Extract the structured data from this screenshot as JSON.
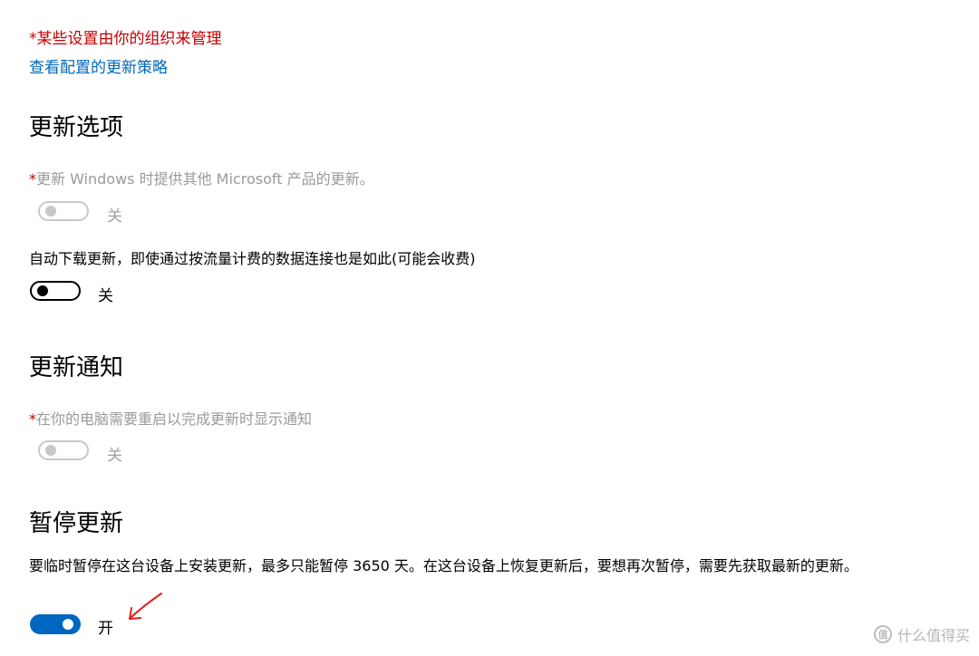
{
  "managed_note": "*某些设置由你的组织来管理",
  "policy_link": "查看配置的更新策略",
  "sections": {
    "update_options": {
      "title": "更新选项",
      "other_products": {
        "star": "*",
        "label": "更新 Windows 时提供其他 Microsoft 产品的更新。",
        "state": "关",
        "on": false,
        "disabled": true
      },
      "metered": {
        "label": "自动下载更新，即使通过按流量计费的数据连接也是如此(可能会收费)",
        "state": "关",
        "on": false,
        "disabled": false
      }
    },
    "notifications": {
      "title": "更新通知",
      "restart_notice": {
        "star": "*",
        "label": "在你的电脑需要重启以完成更新时显示通知",
        "state": "关",
        "on": false,
        "disabled": true
      }
    },
    "pause": {
      "title": "暂停更新",
      "description": "要临时暂停在这台设备上安装更新，最多只能暂停 3650 天。在这台设备上恢复更新后，要想再次暂停，需要先获取最新的更新。",
      "state": "开",
      "on": true,
      "disabled": false
    }
  },
  "watermark": {
    "logo_text": "值",
    "text": "什么值得买"
  },
  "colors": {
    "accent": "#0067c0",
    "link": "#0067b8",
    "managed_red": "#c40000",
    "annotation_red": "#e02020",
    "disabled_gray": "#9a9a9a"
  }
}
